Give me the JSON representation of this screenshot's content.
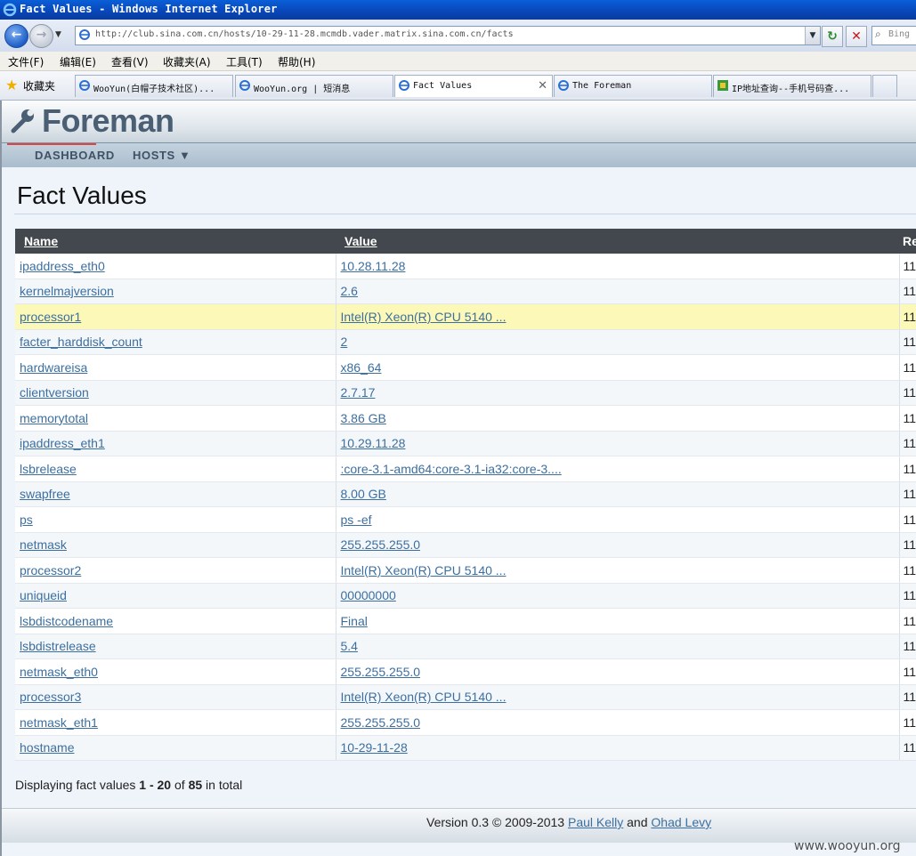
{
  "window": {
    "title": "Fact Values - Windows Internet Explorer"
  },
  "addressbar": {
    "url": "http://club.sina.com.cn/hosts/10-29-11-28.mcmdb.vader.matrix.sina.com.cn/facts",
    "search_placeholder": "Bing"
  },
  "menu": [
    "文件(F)",
    "编辑(E)",
    "查看(V)",
    "收藏夹(A)",
    "工具(T)",
    "帮助(H)"
  ],
  "favorites": {
    "label": "收藏夹"
  },
  "tabs": [
    {
      "label": "WooYun(白帽子技术社区)..."
    },
    {
      "label": "WooYun.org | 短消息"
    },
    {
      "label": "Fact Values"
    },
    {
      "label": "The Foreman"
    },
    {
      "label": "IP地址查询--手机号码查..."
    }
  ],
  "app": {
    "brand": "Foreman",
    "nav": {
      "dashboard": "DASHBOARD",
      "hosts": "HOSTS ▼"
    }
  },
  "page": {
    "title": "Fact Values"
  },
  "table": {
    "headers": {
      "name": "Name",
      "value": "Value",
      "reported": "Re"
    },
    "rows": [
      {
        "name": "ipaddress_eth0",
        "value": "10.28.11.28",
        "reported": "11"
      },
      {
        "name": "kernelmajversion",
        "value": "2.6",
        "reported": "11"
      },
      {
        "name": "processor1",
        "value": "Intel(R) Xeon(R) CPU 5140 ...",
        "reported": "11"
      },
      {
        "name": "facter_harddisk_count",
        "value": "2",
        "reported": "11"
      },
      {
        "name": "hardwareisa",
        "value": "x86_64",
        "reported": "11"
      },
      {
        "name": "clientversion",
        "value": "2.7.17",
        "reported": "11"
      },
      {
        "name": "memorytotal",
        "value": "3.86 GB",
        "reported": "11"
      },
      {
        "name": "ipaddress_eth1",
        "value": "10.29.11.28",
        "reported": "11"
      },
      {
        "name": "lsbrelease",
        "value": ":core-3.1-amd64:core-3.1-ia32:core-3....",
        "reported": "11"
      },
      {
        "name": "swapfree",
        "value": "8.00 GB",
        "reported": "11"
      },
      {
        "name": "ps",
        "value": "ps -ef",
        "reported": "11"
      },
      {
        "name": "netmask",
        "value": "255.255.255.0",
        "reported": "11"
      },
      {
        "name": "processor2",
        "value": "Intel(R) Xeon(R) CPU 5140 ...",
        "reported": "11"
      },
      {
        "name": "uniqueid",
        "value": "00000000",
        "reported": "11"
      },
      {
        "name": "lsbdistcodename",
        "value": "Final",
        "reported": "11"
      },
      {
        "name": "lsbdistrelease",
        "value": "5.4",
        "reported": "11"
      },
      {
        "name": "netmask_eth0",
        "value": "255.255.255.0",
        "reported": "11"
      },
      {
        "name": "processor3",
        "value": "Intel(R) Xeon(R) CPU 5140 ...",
        "reported": "11"
      },
      {
        "name": "netmask_eth1",
        "value": "255.255.255.0",
        "reported": "11"
      },
      {
        "name": "hostname",
        "value": "10-29-11-28",
        "reported": "11"
      }
    ]
  },
  "pagination": {
    "prefix": "Displaying fact values ",
    "range": "1 - 20",
    "of": " of ",
    "total": "85",
    "suffix": " in total"
  },
  "footer": {
    "version": "Version 0.3 © 2009-2013 ",
    "author1": "Paul Kelly",
    "and": " and ",
    "author2": "Ohad Levy"
  },
  "watermark": "www.wooyun.org",
  "colors": {
    "header_bg": "#43484e",
    "link": "#3c6fa0",
    "highlight_row": "#fcf9b8",
    "brand": "#4a5f74"
  }
}
